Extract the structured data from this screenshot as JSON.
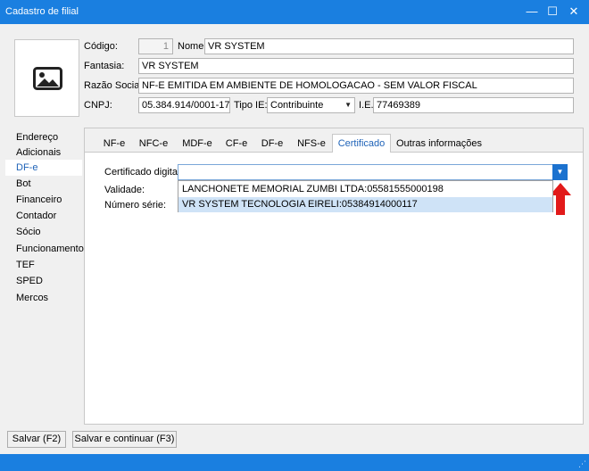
{
  "window": {
    "title": "Cadastro de filial",
    "minimize_glyph": "—",
    "maximize_glyph": "☐",
    "close_glyph": "✕"
  },
  "header": {
    "codigo_label": "Código:",
    "codigo_value": "1",
    "nome_label": "Nome:",
    "nome_value": "VR SYSTEM",
    "fantasia_label": "Fantasia:",
    "fantasia_value": "VR SYSTEM",
    "razao_label": "Razão Social:",
    "razao_value": "NF-E EMITIDA EM AMBIENTE DE HOMOLOGACAO - SEM VALOR FISCAL",
    "cnpj_label": "CNPJ:",
    "cnpj_value": "05.384.914/0001-17",
    "tipo_ie_label": "Tipo IE:",
    "tipo_ie_value": "Contribuinte",
    "ie_label": "I.E.:",
    "ie_value": "77469389"
  },
  "sidebar": {
    "items": [
      {
        "label": "Endereço"
      },
      {
        "label": "Adicionais"
      },
      {
        "label": "DF-e"
      },
      {
        "label": "Bot"
      },
      {
        "label": "Financeiro"
      },
      {
        "label": "Contador"
      },
      {
        "label": "Sócio"
      },
      {
        "label": "Funcionamento"
      },
      {
        "label": "TEF"
      },
      {
        "label": "SPED"
      },
      {
        "label": "Mercos"
      }
    ],
    "active": "DF-e"
  },
  "tabs": [
    {
      "label": "NF-e"
    },
    {
      "label": "NFC-e"
    },
    {
      "label": "MDF-e"
    },
    {
      "label": "CF-e"
    },
    {
      "label": "DF-e"
    },
    {
      "label": "NFS-e"
    },
    {
      "label": "Certificado"
    },
    {
      "label": "Outras informações"
    }
  ],
  "active_tab": "Certificado",
  "certificado": {
    "certificado_label": "Certificado digital:",
    "validade_label": "Validade:",
    "numero_serie_label": "Número série:",
    "options": [
      "LANCHONETE MEMORIAL ZUMBI LTDA:05581555000198",
      "VR SYSTEM TECNOLOGIA EIRELI:05384914000117"
    ],
    "highlighted_index": 1
  },
  "footer": {
    "salvar_label": "Salvar (F2)",
    "salvar_continuar_label": "Salvar e continuar (F3)"
  },
  "colors": {
    "accent": "#1a7fe0",
    "annotation_arrow": "#e21a1a"
  }
}
